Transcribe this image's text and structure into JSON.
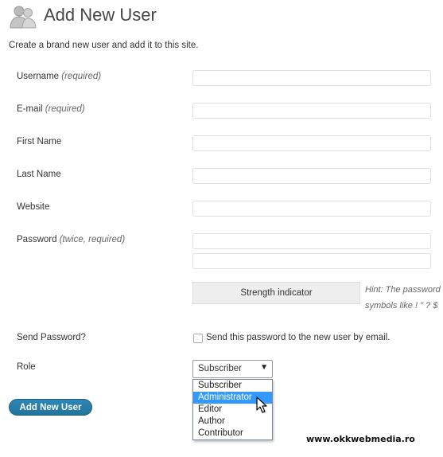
{
  "header": {
    "icon": "users-icon",
    "title": "Add New User",
    "description": "Create a brand new user and add it to this site."
  },
  "form": {
    "username": {
      "label": "Username",
      "note": "(required)",
      "value": ""
    },
    "email": {
      "label": "E-mail",
      "note": "(required)",
      "value": ""
    },
    "first_name": {
      "label": "First Name",
      "value": ""
    },
    "last_name": {
      "label": "Last Name",
      "value": ""
    },
    "website": {
      "label": "Website",
      "value": ""
    },
    "password": {
      "label": "Password",
      "note": "(twice, required)",
      "value1": "",
      "value2": ""
    },
    "strength_indicator": "Strength indicator",
    "hint": {
      "line1": "Hint: The password",
      "line2": "symbols like ! \" ? $"
    },
    "send_password": {
      "label": "Send Password?",
      "checkbox_label": "Send this password to the new user by email.",
      "checked": false
    },
    "role": {
      "label": "Role",
      "selected": "Subscriber",
      "arrow": "▼",
      "options": [
        "Subscriber",
        "Administrator",
        "Editor",
        "Author",
        "Contributor"
      ],
      "highlighted": "Administrator"
    },
    "submit_label": "Add New User"
  },
  "watermark": "www.okkwebmedia.ro",
  "colors": {
    "primary_button": "#21759b",
    "highlight": "#3399ff",
    "title": "#464646"
  }
}
